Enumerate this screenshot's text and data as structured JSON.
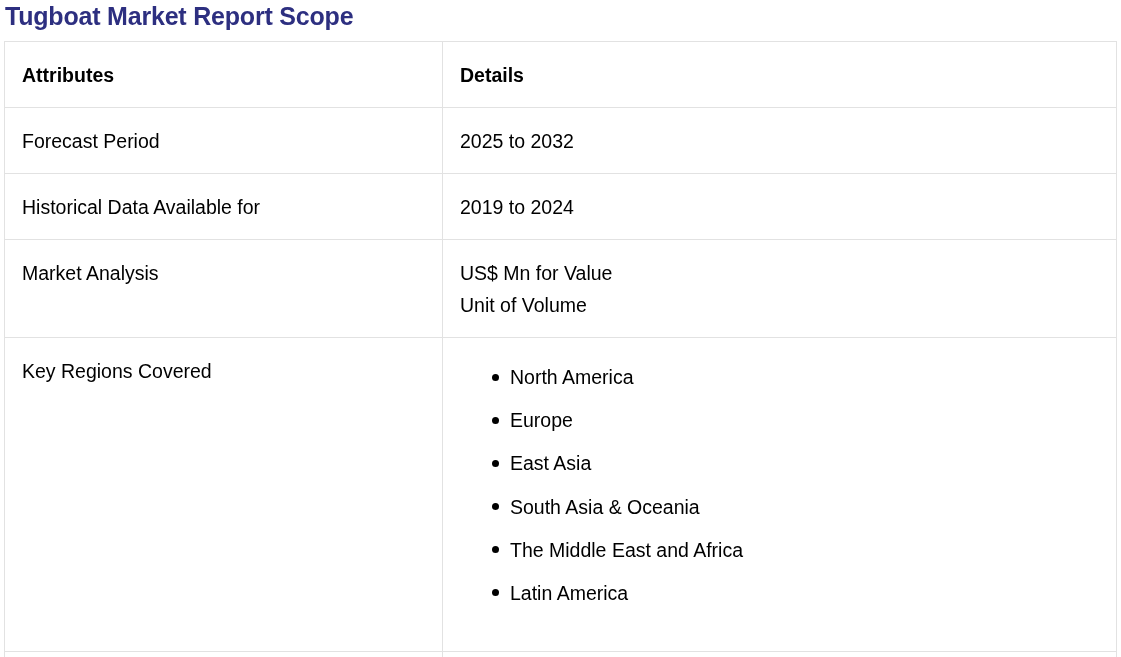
{
  "title": "Tugboat Market Report Scope",
  "table": {
    "columns": [
      "Attributes",
      "Details"
    ],
    "rows": [
      {
        "attribute": "Forecast Period",
        "kind": "text",
        "value": "2025 to 2032"
      },
      {
        "attribute": "Historical Data Available for",
        "kind": "text",
        "value": "2019 to 2024"
      },
      {
        "attribute": "Market Analysis",
        "kind": "lines",
        "lines": [
          "US$ Mn for Value",
          "Unit of Volume"
        ]
      },
      {
        "attribute": "Key Regions Covered",
        "kind": "list",
        "items": [
          "North America",
          "Europe",
          "East Asia",
          "South Asia & Oceania",
          "The Middle East and Africa",
          "Latin America"
        ]
      }
    ]
  }
}
